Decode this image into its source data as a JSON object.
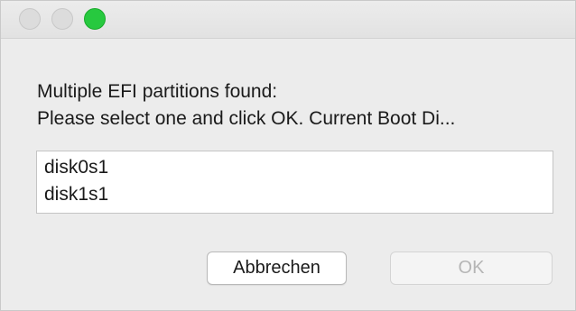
{
  "window": {
    "traffic_lights": {
      "close": {
        "color": "#dcdcdc",
        "icon": "close-icon"
      },
      "minimize": {
        "color": "#dcdcdc",
        "icon": "minimize-icon"
      },
      "zoom": {
        "color": "#27c93f",
        "icon": "zoom-icon"
      }
    }
  },
  "dialog": {
    "message_line1": "Multiple EFI partitions found:",
    "message_line2": "Please select one and click OK. Current Boot Di...",
    "partitions": [
      "disk0s1",
      "disk1s1"
    ],
    "buttons": {
      "cancel_label": "Abbrechen",
      "ok_label": "OK",
      "ok_enabled": false
    }
  }
}
